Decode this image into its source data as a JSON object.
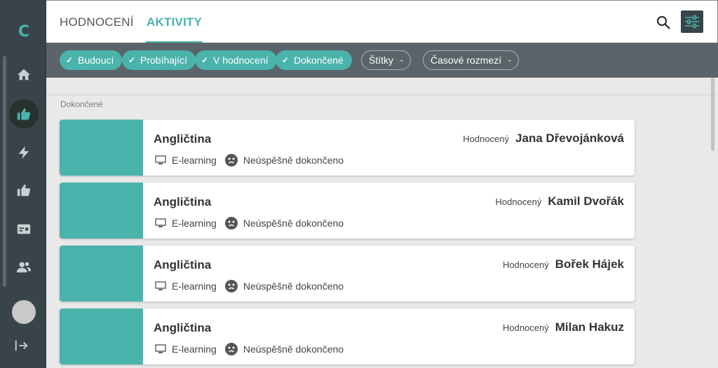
{
  "app": {
    "logo": "C"
  },
  "sidebar": {
    "items": [
      {
        "icon": "home-icon"
      },
      {
        "icon": "thumbs-up-icon",
        "active": true
      },
      {
        "icon": "lightning-icon"
      },
      {
        "icon": "thumbs-up-icon"
      },
      {
        "icon": "id-card-icon"
      },
      {
        "icon": "people-icon"
      }
    ]
  },
  "tabs": [
    {
      "label": "HODNOCENÍ"
    },
    {
      "label": "AKTIVITY",
      "active": true
    }
  ],
  "filters": {
    "chips": [
      {
        "label": "Budoucí"
      },
      {
        "label": "Probíhající"
      },
      {
        "label": "V hodnocení"
      },
      {
        "label": "Dokončené"
      }
    ],
    "dropdowns": [
      {
        "label": "Štítky"
      },
      {
        "label": "Časové rozmezí"
      }
    ]
  },
  "section": {
    "label": "Dokončené"
  },
  "cards": [
    {
      "title": "Angličtina",
      "type": "E-learning",
      "status": "Neúspěšně dokončeno",
      "evaluator_label": "Hodnocený",
      "evaluator": "Jana Dřevojánková"
    },
    {
      "title": "Angličtina",
      "type": "E-learning",
      "status": "Neúspěšně dokončeno",
      "evaluator_label": "Hodnocený",
      "evaluator": "Kamil Dvořák"
    },
    {
      "title": "Angličtina",
      "type": "E-learning",
      "status": "Neúspěšně dokončeno",
      "evaluator_label": "Hodnocený",
      "evaluator": "Bořek Hájek"
    },
    {
      "title": "Angličtina",
      "type": "E-learning",
      "status": "Neúspěšně dokončeno",
      "evaluator_label": "Hodnocený",
      "evaluator": "Milan Hakuz"
    }
  ],
  "colors": {
    "accent": "#4ab3ac",
    "sidebar": "#38444a",
    "filterbar": "#5a6469"
  }
}
